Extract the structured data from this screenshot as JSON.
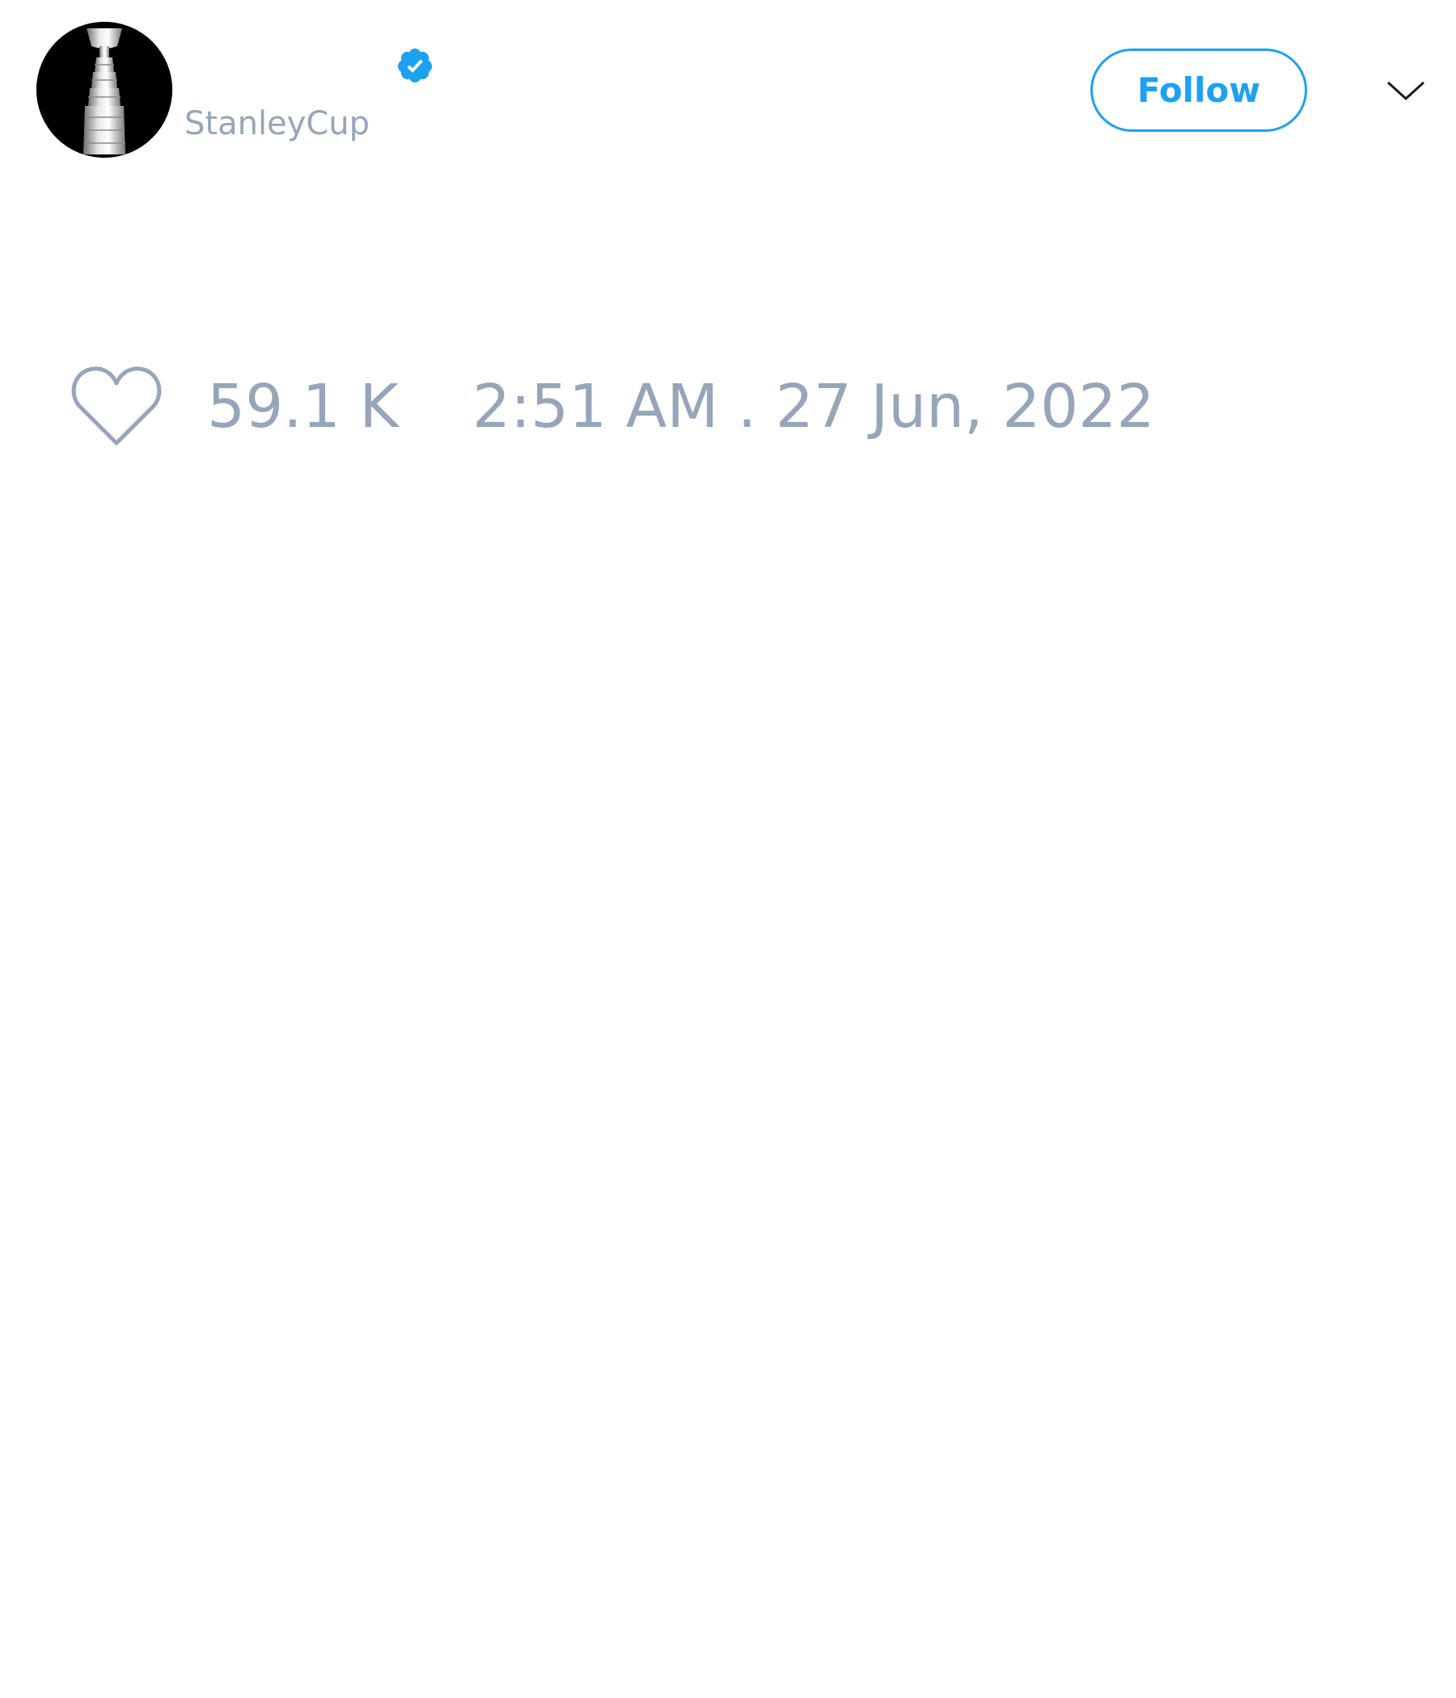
{
  "tweet": {
    "author": {
      "handle": "StanleyCup",
      "verified": true,
      "avatar_icon": "stanley-cup-trophy-icon"
    },
    "follow_label": "Follow",
    "menu_icon": "chevron-down-icon",
    "like_icon": "heart-outline-icon",
    "like_count": "59.1 K",
    "timestamp": "2:51 AM . 27 Jun, 2022"
  },
  "colors": {
    "accent": "#1da1f2",
    "muted_text": "#97a5b8",
    "background": "#ffffff"
  }
}
